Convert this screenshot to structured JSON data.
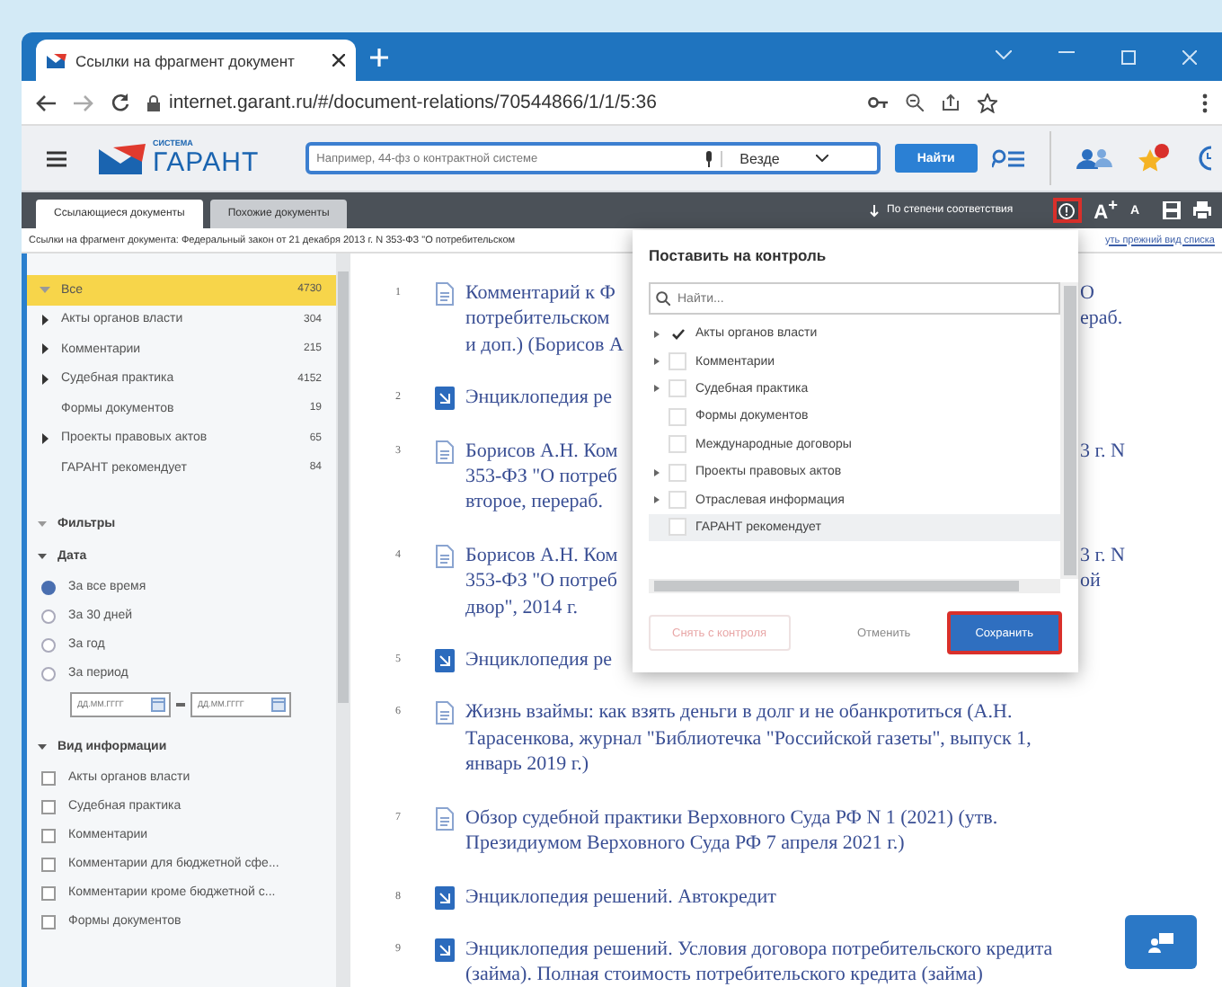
{
  "browser": {
    "tab_title": "Ссылки на фрагмент документ",
    "url": "internet.garant.ru/#/document-relations/70544866/1/1/5:36"
  },
  "header": {
    "logo_small": "СИСТЕМА",
    "logo": "ГАРАНТ",
    "search_placeholder": "Например, 44-фз о контрактной системе",
    "scope": "Везде",
    "search_button": "Найти"
  },
  "toolbar": {
    "tabs": [
      {
        "label": "Ссылающиеся документы",
        "selected": true
      },
      {
        "label": "Похожие документы",
        "selected": false
      }
    ],
    "sort": "По степени соответствия",
    "font_larger": "A$^{+}$",
    "font_smaller": "A"
  },
  "breadcrumb": "Ссылки на фрагмент документа: Федеральный закон от 21 декабря 2013 г. N 353-ФЗ \"О потребительском",
  "restore_link": "уть прежний вид списка",
  "sidebar": {
    "categories": [
      {
        "label": "Все",
        "count": "4730",
        "kind": "group",
        "expanded": true,
        "selected": true
      },
      {
        "label": "Акты органов власти",
        "count": "304",
        "kind": "group",
        "expanded": false,
        "selected": false
      },
      {
        "label": "Комментарии",
        "count": "215",
        "kind": "group",
        "expanded": false,
        "selected": false
      },
      {
        "label": "Судебная практика",
        "count": "4152",
        "kind": "group",
        "expanded": false,
        "selected": false
      },
      {
        "label": "Формы документов",
        "count": "19",
        "kind": "leaf",
        "selected": false
      },
      {
        "label": "Проекты правовых актов",
        "count": "65",
        "kind": "group",
        "expanded": false,
        "selected": false
      },
      {
        "label": "ГАРАНТ рекомендует",
        "count": "84",
        "kind": "leaf",
        "selected": false
      }
    ],
    "filters_title": "Фильтры",
    "date_title": "Дата",
    "date_options": [
      {
        "label": "За все время",
        "selected": true
      },
      {
        "label": "За 30 дней",
        "selected": false
      },
      {
        "label": "За год",
        "selected": false
      },
      {
        "label": "За период",
        "selected": false
      }
    ],
    "date_from_placeholder": "ДД.ММ.ГГГГ",
    "date_to_placeholder": "ДД.ММ.ГГГГ",
    "info_title": "Вид информации",
    "info_types": [
      {
        "label": "Акты органов власти",
        "checked": false
      },
      {
        "label": "Судебная практика",
        "checked": false
      },
      {
        "label": "Комментарии",
        "checked": false
      },
      {
        "label": "Комментарии для бюджетной сфе...",
        "checked": false
      },
      {
        "label": "Комментарии кроме бюджетной с...",
        "checked": false
      },
      {
        "label": "Формы документов",
        "checked": false
      }
    ]
  },
  "documents": [
    {
      "number": "1",
      "kind": "commentary",
      "lines": [
        {
          "left": "Комментарий к Ф",
          "right": "О"
        },
        {
          "left": "потребительском",
          "right": "ераб."
        },
        {
          "left": "и доп.) (Борисов А"
        }
      ]
    },
    {
      "number": "2",
      "kind": "encyclopedia",
      "lines": [
        {
          "left": "Энциклопедия ре"
        }
      ]
    },
    {
      "number": "3",
      "kind": "commentary",
      "lines": [
        {
          "left": "Борисов А.Н. Ком",
          "right": "3 г. N"
        },
        {
          "left": "353-ФЗ \"О потреб"
        },
        {
          "left": "второе, перераб."
        }
      ]
    },
    {
      "number": "4",
      "kind": "commentary",
      "lines": [
        {
          "left": "Борисов А.Н. Ком",
          "right": "3 г. N"
        },
        {
          "left": "353-ФЗ \"О потреб",
          "right": "ой"
        },
        {
          "left": "двор\", 2014 г."
        }
      ]
    },
    {
      "number": "5",
      "kind": "encyclopedia",
      "lines": [
        {
          "left": "Энциклопедия ре"
        }
      ]
    },
    {
      "number": "6",
      "kind": "commentary",
      "text": "Жизнь взаймы: как взять деньги в долг и не обанкротиться (А.Н. Тарасенкова, журнал \"Библиотечка \"Российской газеты\", выпуск 1, январь 2019 г.)"
    },
    {
      "number": "7",
      "kind": "commentary",
      "text": "Обзор судебной практики Верховного Суда РФ N 1 (2021) (утв. Президиумом Верховного Суда РФ 7 апреля 2021 г.)"
    },
    {
      "number": "8",
      "kind": "encyclopedia",
      "text": "Энциклопедия решений. Автокредит"
    },
    {
      "number": "9",
      "kind": "encyclopedia",
      "text": "Энциклопедия решений. Условия договора потребительского кредита (займа). Полная стоимость потребительского кредита (займа)"
    }
  ],
  "dialog": {
    "title": "Поставить на контроль",
    "search_placeholder": "Найти...",
    "items": [
      {
        "label": "Акты органов власти",
        "kind": "group",
        "checked": true,
        "highlighted": false
      },
      {
        "label": "Комментарии",
        "kind": "group",
        "checked": false,
        "highlighted": false
      },
      {
        "label": "Судебная практика",
        "kind": "group",
        "checked": false,
        "highlighted": false
      },
      {
        "label": "Формы документов",
        "kind": "leaf",
        "checked": false,
        "highlighted": false
      },
      {
        "label": "Международные договоры",
        "kind": "leaf",
        "checked": false,
        "highlighted": false
      },
      {
        "label": "Проекты правовых актов",
        "kind": "group",
        "checked": false,
        "highlighted": false
      },
      {
        "label": "Отраслевая информация",
        "kind": "group",
        "checked": false,
        "highlighted": false
      },
      {
        "label": "ГАРАНТ рекомендует",
        "kind": "leaf",
        "checked": false,
        "highlighted": true
      }
    ],
    "buttons": [
      {
        "label": "Снять с контроля",
        "kind": "remove",
        "disabled": true
      },
      {
        "label": "Отменить",
        "kind": "cancel",
        "disabled": false
      },
      {
        "label": "Сохранить",
        "kind": "save",
        "disabled": false
      }
    ]
  }
}
